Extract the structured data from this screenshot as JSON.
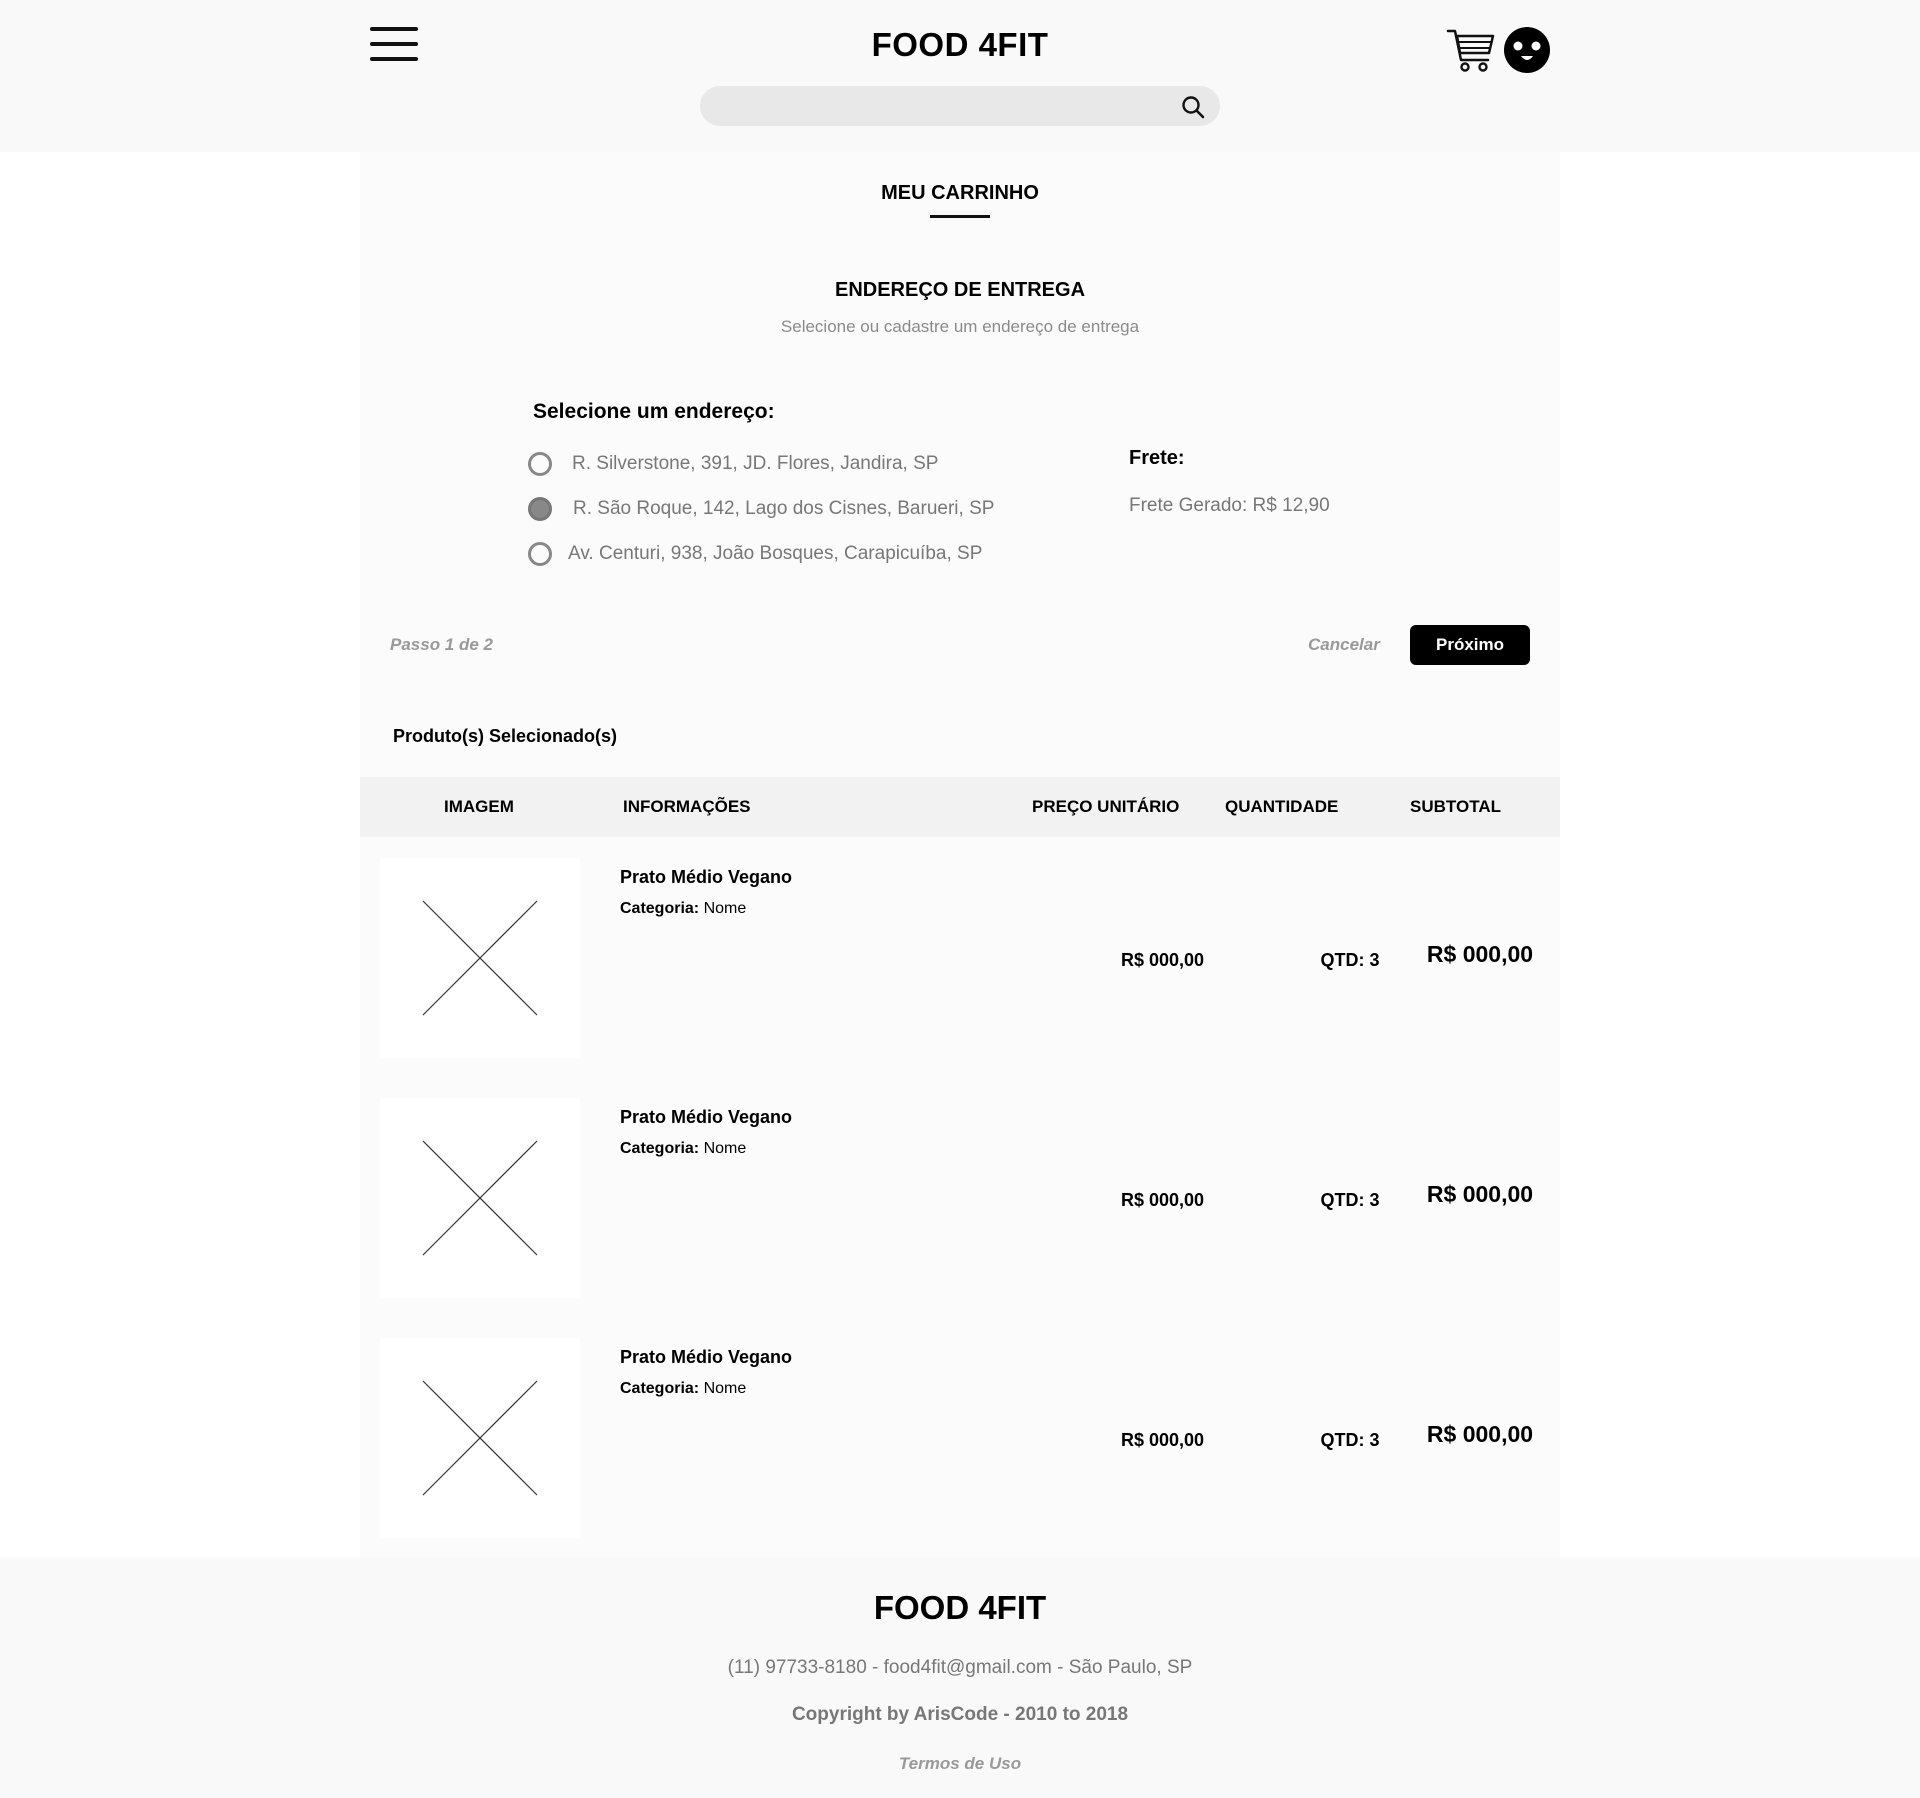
{
  "header": {
    "brand": "FOOD 4FIT",
    "search_placeholder": "",
    "icons": [
      "menu-icon",
      "search-icon",
      "cart-icon",
      "avatar-icon"
    ]
  },
  "cart": {
    "title": "MEU CARRINHO",
    "address_title": "ENDEREÇO DE ENTREGA",
    "address_subtitle": "Selecione ou cadastre um endereço de entrega",
    "select_label": "Selecione um endereço:",
    "addresses": [
      {
        "label": "R. Silverstone, 391, JD. Flores, Jandira, SP",
        "selected": false
      },
      {
        "label": "R. São Roque, 142, Lago dos Cisnes, Barueri, SP",
        "selected": true
      },
      {
        "label": "Av. Centuri, 938, João Bosques, Carapicuíba, SP",
        "selected": false
      }
    ],
    "frete_label": "Frete:",
    "frete_value": "Frete Gerado: R$ 12,90",
    "step": "Passo 1 de 2",
    "cancel": "Cancelar",
    "next": "Próximo",
    "products_label": "Produto(s) Selecionado(s)"
  },
  "table": {
    "columns": [
      "IMAGEM",
      "INFORMAÇÕES",
      "PREÇO UNITÁRIO",
      "QUANTIDADE",
      "SUBTOTAL"
    ],
    "rows": [
      {
        "name": "Prato Médio Vegano",
        "category_label": "Categoria:",
        "category": "Nome",
        "price": "R$ 000,00",
        "qty": "QTD: 3",
        "subtotal": "R$ 000,00"
      },
      {
        "name": "Prato Médio Vegano",
        "category_label": "Categoria:",
        "category": "Nome",
        "price": "R$ 000,00",
        "qty": "QTD: 3",
        "subtotal": "R$ 000,00"
      },
      {
        "name": "Prato Médio Vegano",
        "category_label": "Categoria:",
        "category": "Nome",
        "price": "R$ 000,00",
        "qty": "QTD: 3",
        "subtotal": "R$ 000,00"
      }
    ]
  },
  "footer": {
    "brand": "FOOD 4FIT",
    "contact": "(11) 97733-8180 - food4fit@gmail.com - São Paulo, SP",
    "copyright": "Copyright by ArisCode - 2010 to 2018",
    "terms": "Termos de Uso"
  }
}
